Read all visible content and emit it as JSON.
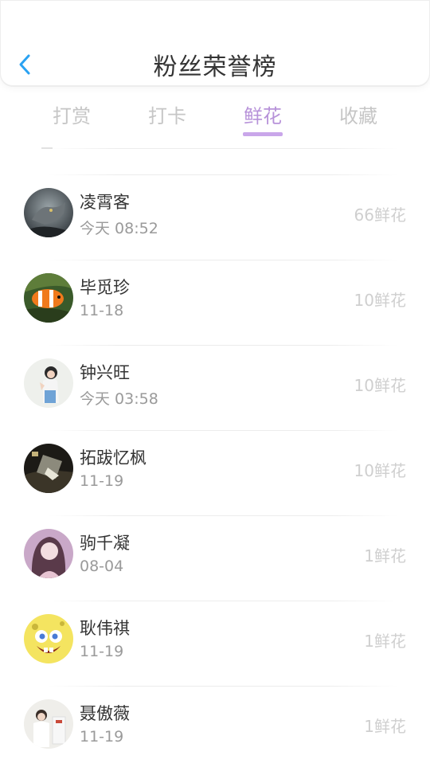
{
  "header": {
    "title": "粉丝荣誉榜",
    "back_icon": "chevron-left-icon",
    "accent": "#2aa2f2"
  },
  "tabs": [
    {
      "label": "打赏",
      "active": false
    },
    {
      "label": "打卡",
      "active": false
    },
    {
      "label": "鲜花",
      "active": true
    },
    {
      "label": "收藏",
      "active": false
    }
  ],
  "colors": {
    "tab_active": "#b792d9",
    "underline": "#c9a6ea",
    "muted": "#c6c6c6"
  },
  "fans": [
    {
      "name": "凌霄客",
      "date": "今天 08:52",
      "flowers": "66鲜花"
    },
    {
      "name": "毕觅珍",
      "date": "11-18",
      "flowers": "10鲜花"
    },
    {
      "name": "钟兴旺",
      "date": "今天 03:58",
      "flowers": "10鲜花"
    },
    {
      "name": "拓跋忆枫",
      "date": "11-19",
      "flowers": "10鲜花"
    },
    {
      "name": "驹千凝",
      "date": "08-04",
      "flowers": "1鲜花"
    },
    {
      "name": "耿伟祺",
      "date": "11-19",
      "flowers": "1鲜花"
    },
    {
      "name": "聂傲薇",
      "date": "11-19",
      "flowers": "1鲜花"
    }
  ]
}
